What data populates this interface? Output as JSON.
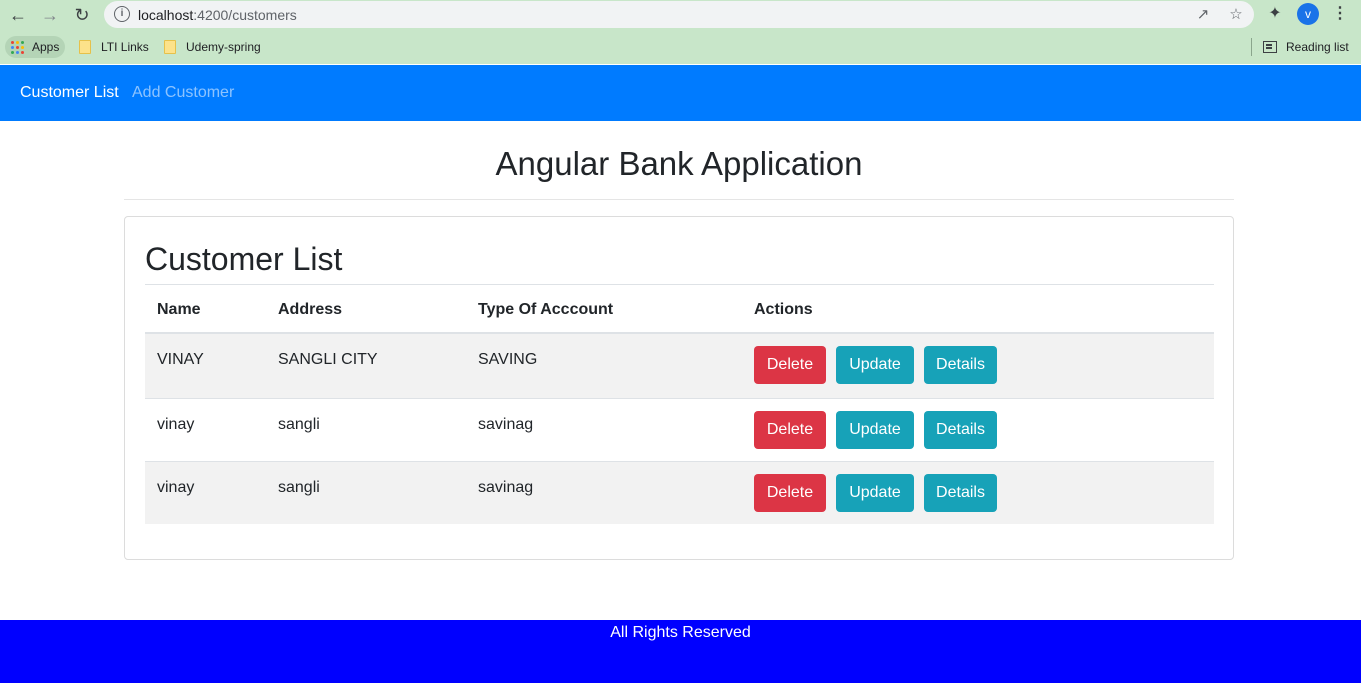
{
  "browser": {
    "url_host": "localhost",
    "url_path": ":4200/customers",
    "avatar_letter": "v",
    "bookmarks": [
      {
        "label": "Apps"
      },
      {
        "label": "LTI Links"
      },
      {
        "label": "Udemy-spring"
      }
    ],
    "reading_list_label": "Reading list"
  },
  "navbar": {
    "brand_color": "#007bff",
    "links": [
      {
        "label": "Customer List",
        "active": true
      },
      {
        "label": "Add Customer",
        "active": false
      }
    ]
  },
  "page": {
    "title": "Angular Bank Application"
  },
  "customer_list": {
    "heading": "Customer List",
    "columns": [
      "Name",
      "Address",
      "Type Of Acccount",
      "Actions"
    ],
    "rows": [
      {
        "name": "VINAY",
        "address": "SANGLI CITY",
        "account_type": "SAVING"
      },
      {
        "name": "vinay",
        "address": "sangli",
        "account_type": "savinag"
      },
      {
        "name": "vinay",
        "address": "sangli",
        "account_type": "savinag"
      }
    ],
    "actions": {
      "delete_label": "Delete",
      "update_label": "Update",
      "details_label": "Details",
      "delete_color": "#dc3545",
      "info_color": "#17a2b8"
    }
  },
  "footer": {
    "text": "All Rights Reserved",
    "color": "#0000ff"
  }
}
